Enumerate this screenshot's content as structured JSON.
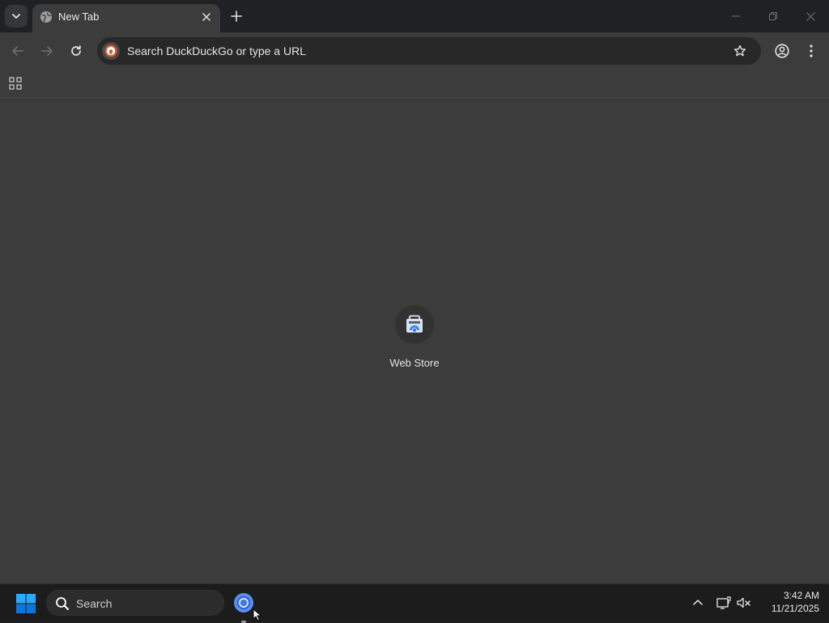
{
  "browser": {
    "tab": {
      "title": "New Tab",
      "favicon": "globe-icon"
    },
    "omnibox": {
      "placeholder": "Search DuckDuckGo or type a URL",
      "search_engine_icon": "duckduckgo-icon"
    },
    "toolbar": {
      "back": "arrow-left-icon",
      "forward": "arrow-right-icon",
      "reload": "reload-icon",
      "bookmark": "star-icon",
      "profile": "profile-icon",
      "menu": "kebab-menu-icon"
    },
    "bookmarks_bar": {
      "apps": "apps-grid-icon"
    },
    "window_controls": [
      "minimize",
      "restore",
      "close"
    ]
  },
  "new_tab_page": {
    "shortcuts": [
      {
        "label": "Web Store",
        "icon": "web-store-icon"
      }
    ]
  },
  "taskbar": {
    "search_label": "Search",
    "pinned_apps": [
      {
        "name": "chrome",
        "icon": "chrome-icon",
        "running": true
      }
    ],
    "clock": {
      "time": "3:42 AM",
      "date": "11/21/2025"
    },
    "tray_icons": [
      "chevron-up-icon",
      "network-icon",
      "volume-muted-icon"
    ]
  },
  "colors": {
    "frame": "#202124",
    "toolbar": "#3c3c3c",
    "omnibox": "#282828",
    "taskbar": "#1c1c1c",
    "windows_blue": "#0078d4"
  }
}
